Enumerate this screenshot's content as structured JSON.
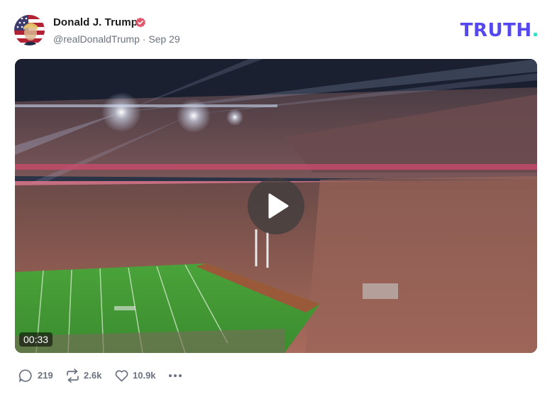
{
  "post": {
    "author_name": "Donald J. Trump",
    "handle": "@realDonaldTrump",
    "separator": "·",
    "date": "Sep 29",
    "verified": true
  },
  "brand": {
    "logo_text": "TRUTH",
    "logo_dot": ".",
    "logo_color": "#5448ee",
    "dot_color": "#2ee0c6"
  },
  "video": {
    "duration": "00:33",
    "play_icon": "play-icon"
  },
  "actions": {
    "replies": "219",
    "retruths": "2.6k",
    "likes": "10.9k",
    "reply_icon": "comment-icon",
    "retruth_icon": "retruth-icon",
    "like_icon": "heart-icon",
    "more_icon": "more-dots-icon"
  },
  "colors": {
    "verified_badge": "#e0566b",
    "muted_text": "#6b7280"
  }
}
